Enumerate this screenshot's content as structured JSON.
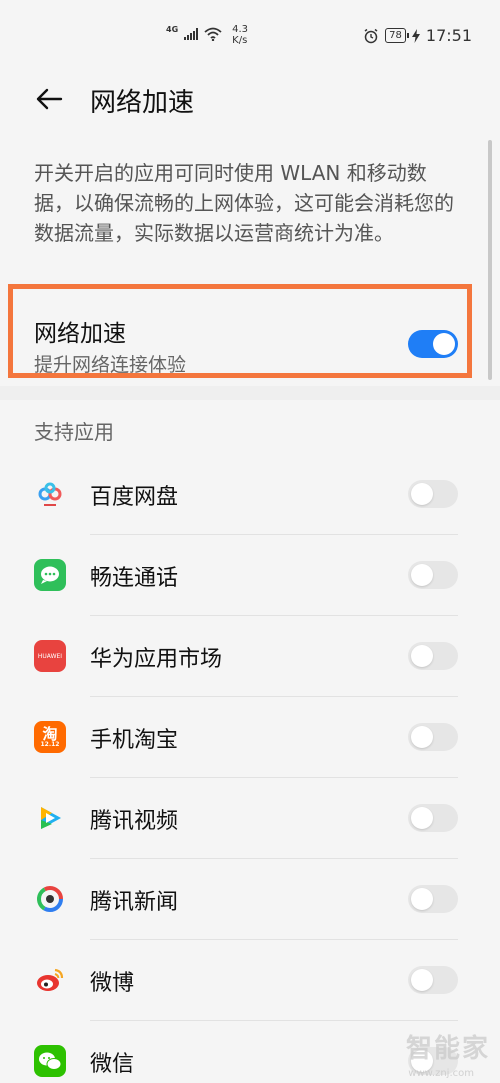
{
  "status_bar": {
    "network_type": "4G",
    "speed_value": "4.3",
    "speed_unit": "K/s",
    "battery": "78",
    "time": "17:51"
  },
  "header": {
    "title": "网络加速"
  },
  "description": "开关开启的应用可同时使用 WLAN 和移动数据，以确保流畅的上网体验，这可能会消耗您的数据流量，实际数据以运营商统计为准。",
  "accelerate": {
    "title": "网络加速",
    "subtitle": "提升网络连接体验",
    "enabled": true
  },
  "section": {
    "label": "支持应用"
  },
  "apps": [
    {
      "name": "百度网盘",
      "enabled": false,
      "icon": "baidu-netdisk-icon",
      "color": "#ffffff"
    },
    {
      "name": "畅连通话",
      "enabled": false,
      "icon": "meetime-icon",
      "color": "#2fbf5a"
    },
    {
      "name": "华为应用市场",
      "enabled": false,
      "icon": "huawei-appgallery-icon",
      "color": "#e8433f"
    },
    {
      "name": "手机淘宝",
      "enabled": false,
      "icon": "taobao-icon",
      "color": "#ff6a00"
    },
    {
      "name": "腾讯视频",
      "enabled": false,
      "icon": "tencent-video-icon",
      "color": "#ffffff"
    },
    {
      "name": "腾讯新闻",
      "enabled": false,
      "icon": "tencent-news-icon",
      "color": "#ffffff"
    },
    {
      "name": "微博",
      "enabled": false,
      "icon": "weibo-icon",
      "color": "#ffffff"
    },
    {
      "name": "微信",
      "enabled": false,
      "icon": "wechat-icon",
      "color": "#2dc100"
    }
  ],
  "colors": {
    "toggle_on": "#1f7ef6",
    "toggle_off": "#e6e6e6",
    "highlight": "#f4763d"
  },
  "icon_text": {
    "huawei": "HUAWEI",
    "taobao_main": "淘",
    "taobao_date": "12.12"
  },
  "watermark": {
    "text": "智能家",
    "url": "www.znj.com"
  }
}
